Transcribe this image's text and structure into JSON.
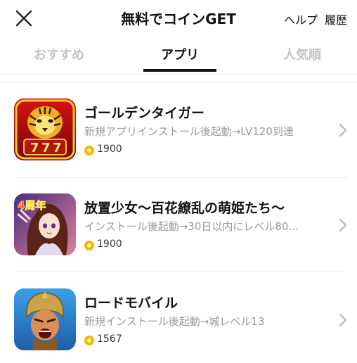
{
  "header": {
    "title": "無料でコインGET",
    "help_label": "ヘルプ",
    "history_label": "履歴"
  },
  "tabs": [
    {
      "label": "おすすめ",
      "active": false
    },
    {
      "label": "アプリ",
      "active": true
    },
    {
      "label": "人気順",
      "active": false
    }
  ],
  "apps": [
    {
      "name": "ゴールデンタイガー",
      "description": "新規アプリインストール後起動→LV120到達",
      "points": "1900",
      "icon": "tiger-slot-icon"
    },
    {
      "name": "放置少女〜百花繚乱の萌姫たち〜",
      "description": "インストール後起動→30日以内にレベル80...",
      "points": "1900",
      "icon": "anime-girl-icon",
      "icon_badge": "4周年"
    },
    {
      "name": "ロードモバイル",
      "description": "新規インストール後起動→城レベル13",
      "points": "1567",
      "icon": "warrior-icon"
    }
  ],
  "colors": {
    "coin": "#f5b800",
    "inactive_tab": "#c4c4c4",
    "description": "#9a9a9a"
  }
}
